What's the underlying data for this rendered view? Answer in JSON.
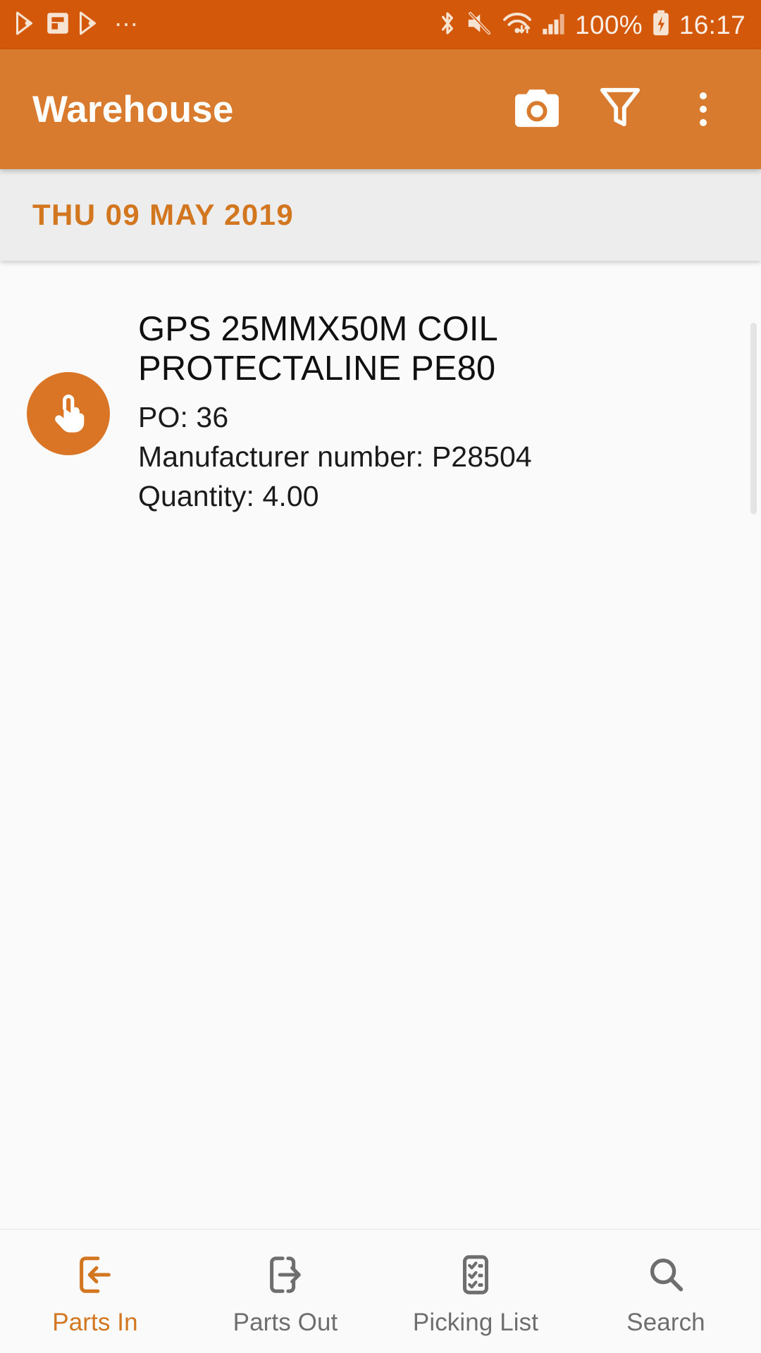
{
  "statusbar": {
    "left_icons": [
      "play-store-icon",
      "flipboard-icon",
      "play-store-icon",
      "more-notifications-icon"
    ],
    "more_dots": "⋯",
    "right_icons": [
      "bluetooth-icon",
      "volume-mute-icon",
      "wifi-icon",
      "cellular-signal-icon",
      "battery-charging-icon"
    ],
    "battery_percent": "100%",
    "time": "16:17",
    "bg_color": "#D4580A",
    "fg_color": "#FAEFE6"
  },
  "appbar": {
    "title": "Warehouse",
    "bg_color": "#D97B2E",
    "actions": [
      {
        "name": "camera-button",
        "icon": "camera-icon"
      },
      {
        "name": "filter-button",
        "icon": "filter-funnel-icon"
      },
      {
        "name": "overflow-menu-button",
        "icon": "more-vertical-icon"
      }
    ]
  },
  "date_header": {
    "text": "THU 09 MAY 2019",
    "color": "#D2761F",
    "bg_color": "#EDEDED"
  },
  "list": {
    "items": [
      {
        "avatar_icon": "touch-hand-icon",
        "avatar_color": "#DB7526",
        "title": "GPS 25MMX50M COIL PROTECTALINE PE80",
        "po": "PO: 36",
        "manufacturer_number": "Manufacturer number: P28504",
        "quantity": "Quantity: 4.00"
      }
    ]
  },
  "bottom_nav": {
    "active_index": 0,
    "active_color": "#D2761F",
    "inactive_color": "#6E6E6E",
    "items": [
      {
        "label": "Parts In",
        "icon": "parts-in-icon"
      },
      {
        "label": "Parts Out",
        "icon": "parts-out-icon"
      },
      {
        "label": "Picking List",
        "icon": "picking-list-icon"
      },
      {
        "label": "Search",
        "icon": "search-icon"
      }
    ]
  }
}
